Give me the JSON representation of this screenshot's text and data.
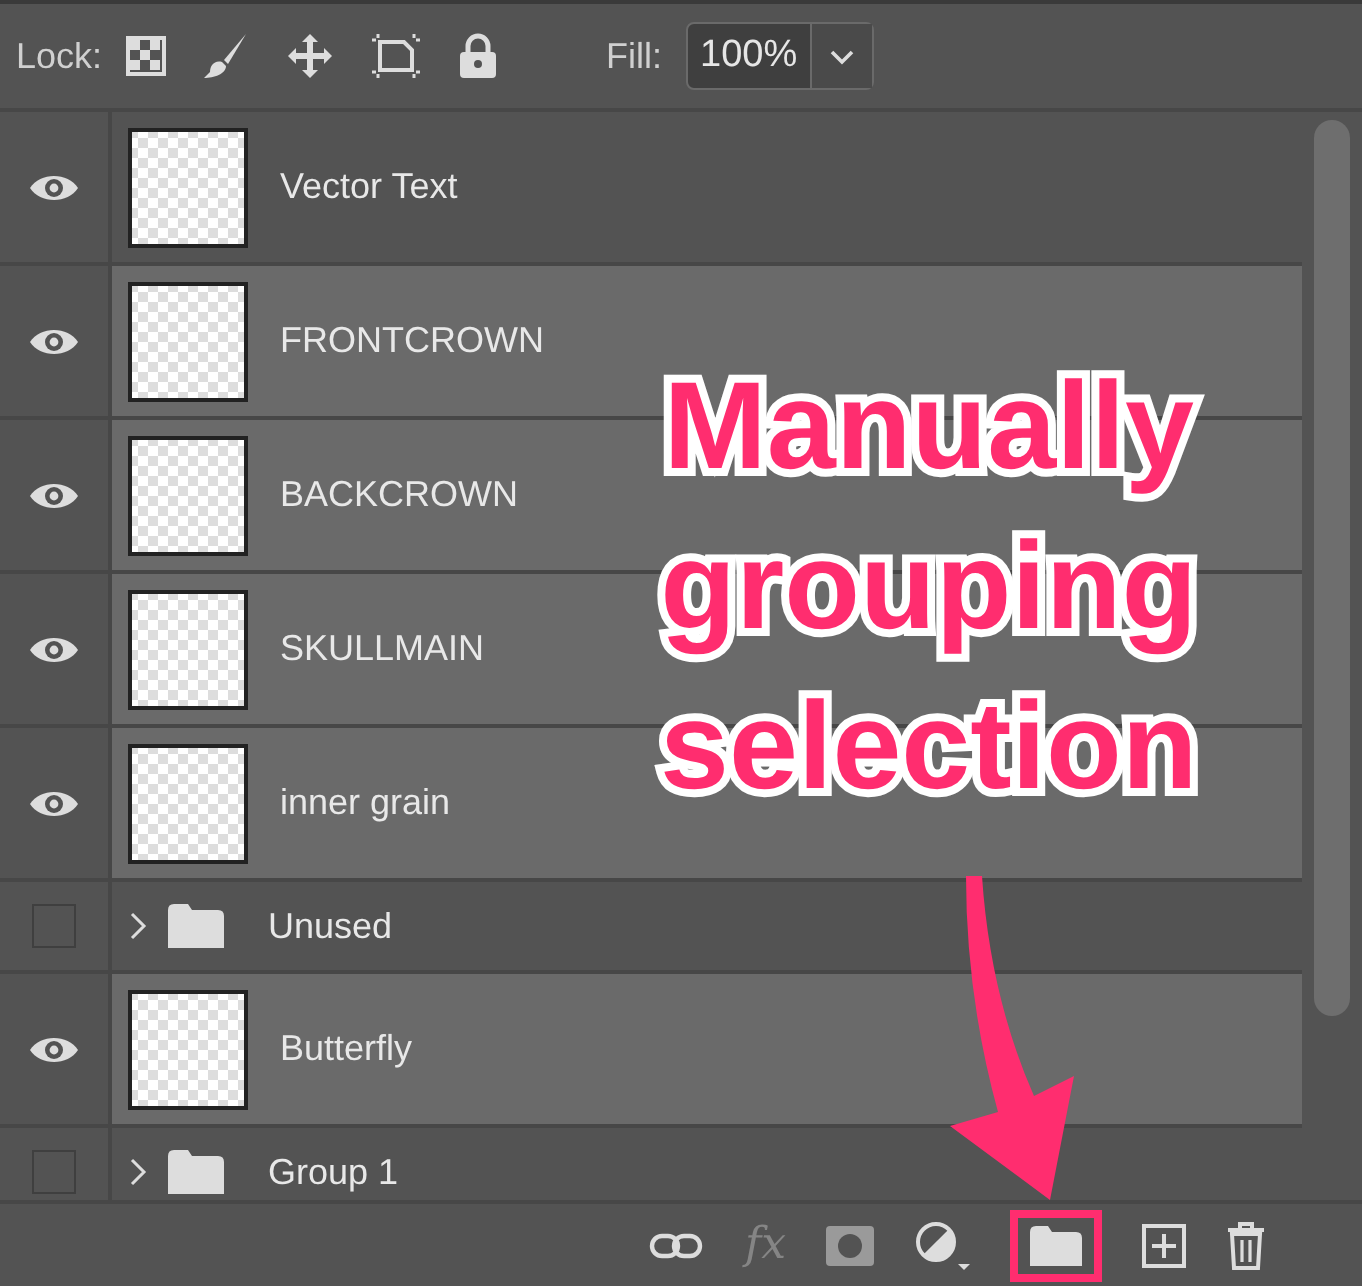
{
  "lock_bar": {
    "label": "Lock:",
    "fill_label": "Fill:",
    "fill_value": "100%"
  },
  "layers": [
    {
      "kind": "layer",
      "name": "Vector Text",
      "visible": true,
      "selected": false
    },
    {
      "kind": "layer",
      "name": "FRONTCROWN",
      "visible": true,
      "selected": true
    },
    {
      "kind": "layer",
      "name": "BACKCROWN",
      "visible": true,
      "selected": true
    },
    {
      "kind": "layer",
      "name": "SKULLMAIN",
      "visible": true,
      "selected": true
    },
    {
      "kind": "layer",
      "name": "inner grain",
      "visible": true,
      "selected": true
    },
    {
      "kind": "group",
      "name": "Unused",
      "visible": false,
      "selected": false,
      "expanded": false
    },
    {
      "kind": "layer",
      "name": "Butterfly",
      "visible": true,
      "selected": true
    },
    {
      "kind": "group",
      "name": "Group 1",
      "visible": false,
      "selected": false,
      "expanded": false
    }
  ],
  "toolbar": [
    {
      "kind": "link",
      "highlighted": false
    },
    {
      "kind": "fx",
      "text": "fx",
      "disabled": true,
      "highlighted": false
    },
    {
      "kind": "mask",
      "highlighted": false
    },
    {
      "kind": "adjustment",
      "highlighted": false
    },
    {
      "kind": "group",
      "highlighted": true
    },
    {
      "kind": "new",
      "highlighted": false
    },
    {
      "kind": "delete",
      "highlighted": false
    }
  ],
  "annotation": {
    "lines": [
      "Manually",
      "grouping",
      "selection"
    ]
  }
}
